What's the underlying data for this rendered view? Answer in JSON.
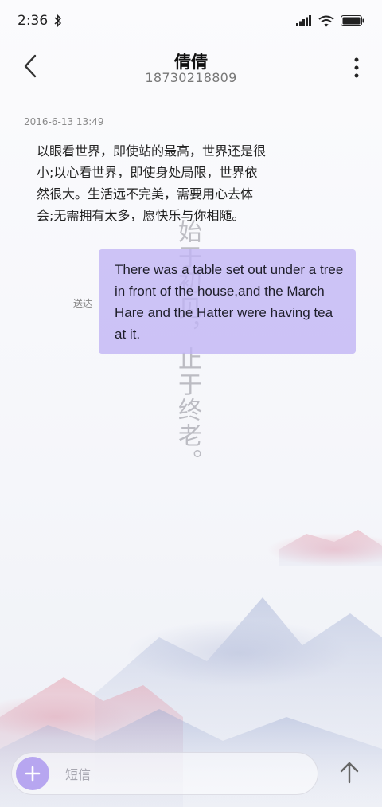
{
  "status": {
    "time": "2:36"
  },
  "header": {
    "contact_name": "倩倩",
    "phone": "18730218809"
  },
  "conversation": {
    "timestamp": "2016-6-13 13:49",
    "incoming_text": "以眼看世界，即使站的最高，世界还是很\n小;以心看世界，即使身处局限，世界依\n然很大。生活远不完美，需要用心去体\n会;无需拥有太多，愿快乐与你相随。",
    "outgoing_text": "There was a table set out under a tree in front of the house,and the March Hare and the Hatter were having tea at it.",
    "outgoing_status": "送达"
  },
  "wallpaper": {
    "vertical_text": "始于初见，止于终老。"
  },
  "composer": {
    "placeholder": "短信"
  },
  "colors": {
    "bubble": "#c0b4f5",
    "accent": "#b7a6f0"
  },
  "icons": {
    "back": "chevron-left-icon",
    "more": "more-vertical-icon",
    "add": "plus-icon",
    "send": "arrow-up-icon",
    "bluetooth": "bluetooth-icon",
    "signal": "signal-icon",
    "wifi": "wifi-icon",
    "battery": "battery-icon"
  }
}
